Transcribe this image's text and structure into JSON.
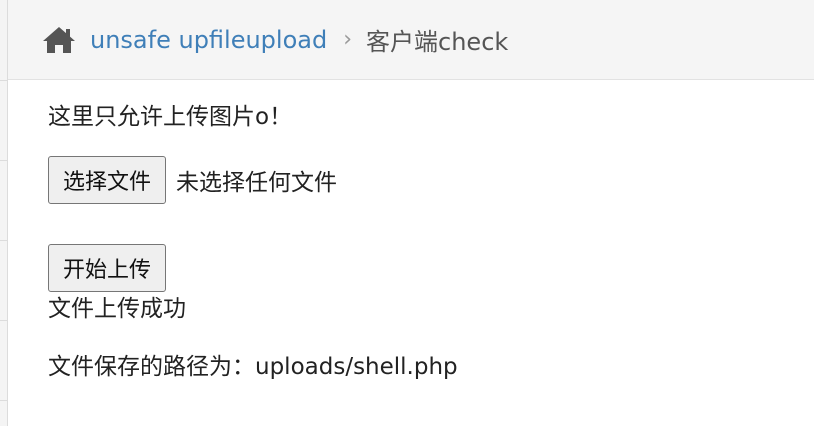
{
  "breadcrumb": {
    "home_icon": "home-icon",
    "link_label": "unsafe upfileupload",
    "separator": "›",
    "current": "客户端check"
  },
  "main": {
    "notice": "这里只允许上传图片o！",
    "file_button_label": "选择文件",
    "file_status": "未选择任何文件",
    "upload_button_label": "开始上传",
    "result_message": "文件上传成功",
    "path_label": "文件保存的路径为：",
    "path_value": "uploads/shell.php"
  },
  "colors": {
    "link": "#3f7fb8",
    "topbar_bg": "#f5f5f5"
  }
}
